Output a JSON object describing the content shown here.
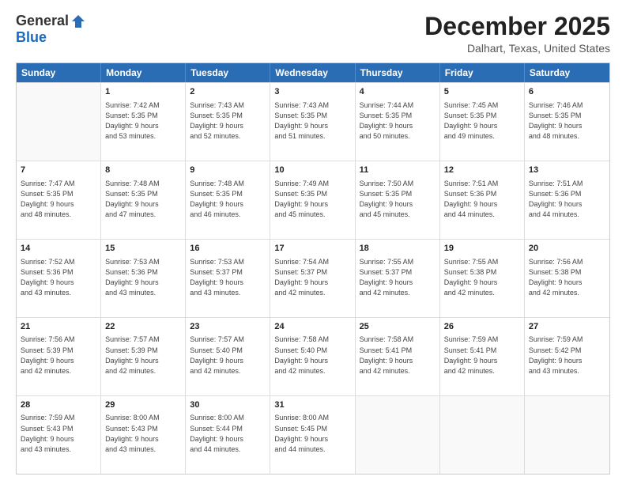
{
  "logo": {
    "general": "General",
    "blue": "Blue"
  },
  "header": {
    "month": "December 2025",
    "location": "Dalhart, Texas, United States"
  },
  "days": [
    "Sunday",
    "Monday",
    "Tuesday",
    "Wednesday",
    "Thursday",
    "Friday",
    "Saturday"
  ],
  "weeks": [
    [
      {
        "day": "",
        "lines": []
      },
      {
        "day": "1",
        "lines": [
          "Sunrise: 7:42 AM",
          "Sunset: 5:35 PM",
          "Daylight: 9 hours",
          "and 53 minutes."
        ]
      },
      {
        "day": "2",
        "lines": [
          "Sunrise: 7:43 AM",
          "Sunset: 5:35 PM",
          "Daylight: 9 hours",
          "and 52 minutes."
        ]
      },
      {
        "day": "3",
        "lines": [
          "Sunrise: 7:43 AM",
          "Sunset: 5:35 PM",
          "Daylight: 9 hours",
          "and 51 minutes."
        ]
      },
      {
        "day": "4",
        "lines": [
          "Sunrise: 7:44 AM",
          "Sunset: 5:35 PM",
          "Daylight: 9 hours",
          "and 50 minutes."
        ]
      },
      {
        "day": "5",
        "lines": [
          "Sunrise: 7:45 AM",
          "Sunset: 5:35 PM",
          "Daylight: 9 hours",
          "and 49 minutes."
        ]
      },
      {
        "day": "6",
        "lines": [
          "Sunrise: 7:46 AM",
          "Sunset: 5:35 PM",
          "Daylight: 9 hours",
          "and 48 minutes."
        ]
      }
    ],
    [
      {
        "day": "7",
        "lines": [
          "Sunrise: 7:47 AM",
          "Sunset: 5:35 PM",
          "Daylight: 9 hours",
          "and 48 minutes."
        ]
      },
      {
        "day": "8",
        "lines": [
          "Sunrise: 7:48 AM",
          "Sunset: 5:35 PM",
          "Daylight: 9 hours",
          "and 47 minutes."
        ]
      },
      {
        "day": "9",
        "lines": [
          "Sunrise: 7:48 AM",
          "Sunset: 5:35 PM",
          "Daylight: 9 hours",
          "and 46 minutes."
        ]
      },
      {
        "day": "10",
        "lines": [
          "Sunrise: 7:49 AM",
          "Sunset: 5:35 PM",
          "Daylight: 9 hours",
          "and 45 minutes."
        ]
      },
      {
        "day": "11",
        "lines": [
          "Sunrise: 7:50 AM",
          "Sunset: 5:35 PM",
          "Daylight: 9 hours",
          "and 45 minutes."
        ]
      },
      {
        "day": "12",
        "lines": [
          "Sunrise: 7:51 AM",
          "Sunset: 5:36 PM",
          "Daylight: 9 hours",
          "and 44 minutes."
        ]
      },
      {
        "day": "13",
        "lines": [
          "Sunrise: 7:51 AM",
          "Sunset: 5:36 PM",
          "Daylight: 9 hours",
          "and 44 minutes."
        ]
      }
    ],
    [
      {
        "day": "14",
        "lines": [
          "Sunrise: 7:52 AM",
          "Sunset: 5:36 PM",
          "Daylight: 9 hours",
          "and 43 minutes."
        ]
      },
      {
        "day": "15",
        "lines": [
          "Sunrise: 7:53 AM",
          "Sunset: 5:36 PM",
          "Daylight: 9 hours",
          "and 43 minutes."
        ]
      },
      {
        "day": "16",
        "lines": [
          "Sunrise: 7:53 AM",
          "Sunset: 5:37 PM",
          "Daylight: 9 hours",
          "and 43 minutes."
        ]
      },
      {
        "day": "17",
        "lines": [
          "Sunrise: 7:54 AM",
          "Sunset: 5:37 PM",
          "Daylight: 9 hours",
          "and 42 minutes."
        ]
      },
      {
        "day": "18",
        "lines": [
          "Sunrise: 7:55 AM",
          "Sunset: 5:37 PM",
          "Daylight: 9 hours",
          "and 42 minutes."
        ]
      },
      {
        "day": "19",
        "lines": [
          "Sunrise: 7:55 AM",
          "Sunset: 5:38 PM",
          "Daylight: 9 hours",
          "and 42 minutes."
        ]
      },
      {
        "day": "20",
        "lines": [
          "Sunrise: 7:56 AM",
          "Sunset: 5:38 PM",
          "Daylight: 9 hours",
          "and 42 minutes."
        ]
      }
    ],
    [
      {
        "day": "21",
        "lines": [
          "Sunrise: 7:56 AM",
          "Sunset: 5:39 PM",
          "Daylight: 9 hours",
          "and 42 minutes."
        ]
      },
      {
        "day": "22",
        "lines": [
          "Sunrise: 7:57 AM",
          "Sunset: 5:39 PM",
          "Daylight: 9 hours",
          "and 42 minutes."
        ]
      },
      {
        "day": "23",
        "lines": [
          "Sunrise: 7:57 AM",
          "Sunset: 5:40 PM",
          "Daylight: 9 hours",
          "and 42 minutes."
        ]
      },
      {
        "day": "24",
        "lines": [
          "Sunrise: 7:58 AM",
          "Sunset: 5:40 PM",
          "Daylight: 9 hours",
          "and 42 minutes."
        ]
      },
      {
        "day": "25",
        "lines": [
          "Sunrise: 7:58 AM",
          "Sunset: 5:41 PM",
          "Daylight: 9 hours",
          "and 42 minutes."
        ]
      },
      {
        "day": "26",
        "lines": [
          "Sunrise: 7:59 AM",
          "Sunset: 5:41 PM",
          "Daylight: 9 hours",
          "and 42 minutes."
        ]
      },
      {
        "day": "27",
        "lines": [
          "Sunrise: 7:59 AM",
          "Sunset: 5:42 PM",
          "Daylight: 9 hours",
          "and 43 minutes."
        ]
      }
    ],
    [
      {
        "day": "28",
        "lines": [
          "Sunrise: 7:59 AM",
          "Sunset: 5:43 PM",
          "Daylight: 9 hours",
          "and 43 minutes."
        ]
      },
      {
        "day": "29",
        "lines": [
          "Sunrise: 8:00 AM",
          "Sunset: 5:43 PM",
          "Daylight: 9 hours",
          "and 43 minutes."
        ]
      },
      {
        "day": "30",
        "lines": [
          "Sunrise: 8:00 AM",
          "Sunset: 5:44 PM",
          "Daylight: 9 hours",
          "and 44 minutes."
        ]
      },
      {
        "day": "31",
        "lines": [
          "Sunrise: 8:00 AM",
          "Sunset: 5:45 PM",
          "Daylight: 9 hours",
          "and 44 minutes."
        ]
      },
      {
        "day": "",
        "lines": []
      },
      {
        "day": "",
        "lines": []
      },
      {
        "day": "",
        "lines": []
      }
    ]
  ]
}
